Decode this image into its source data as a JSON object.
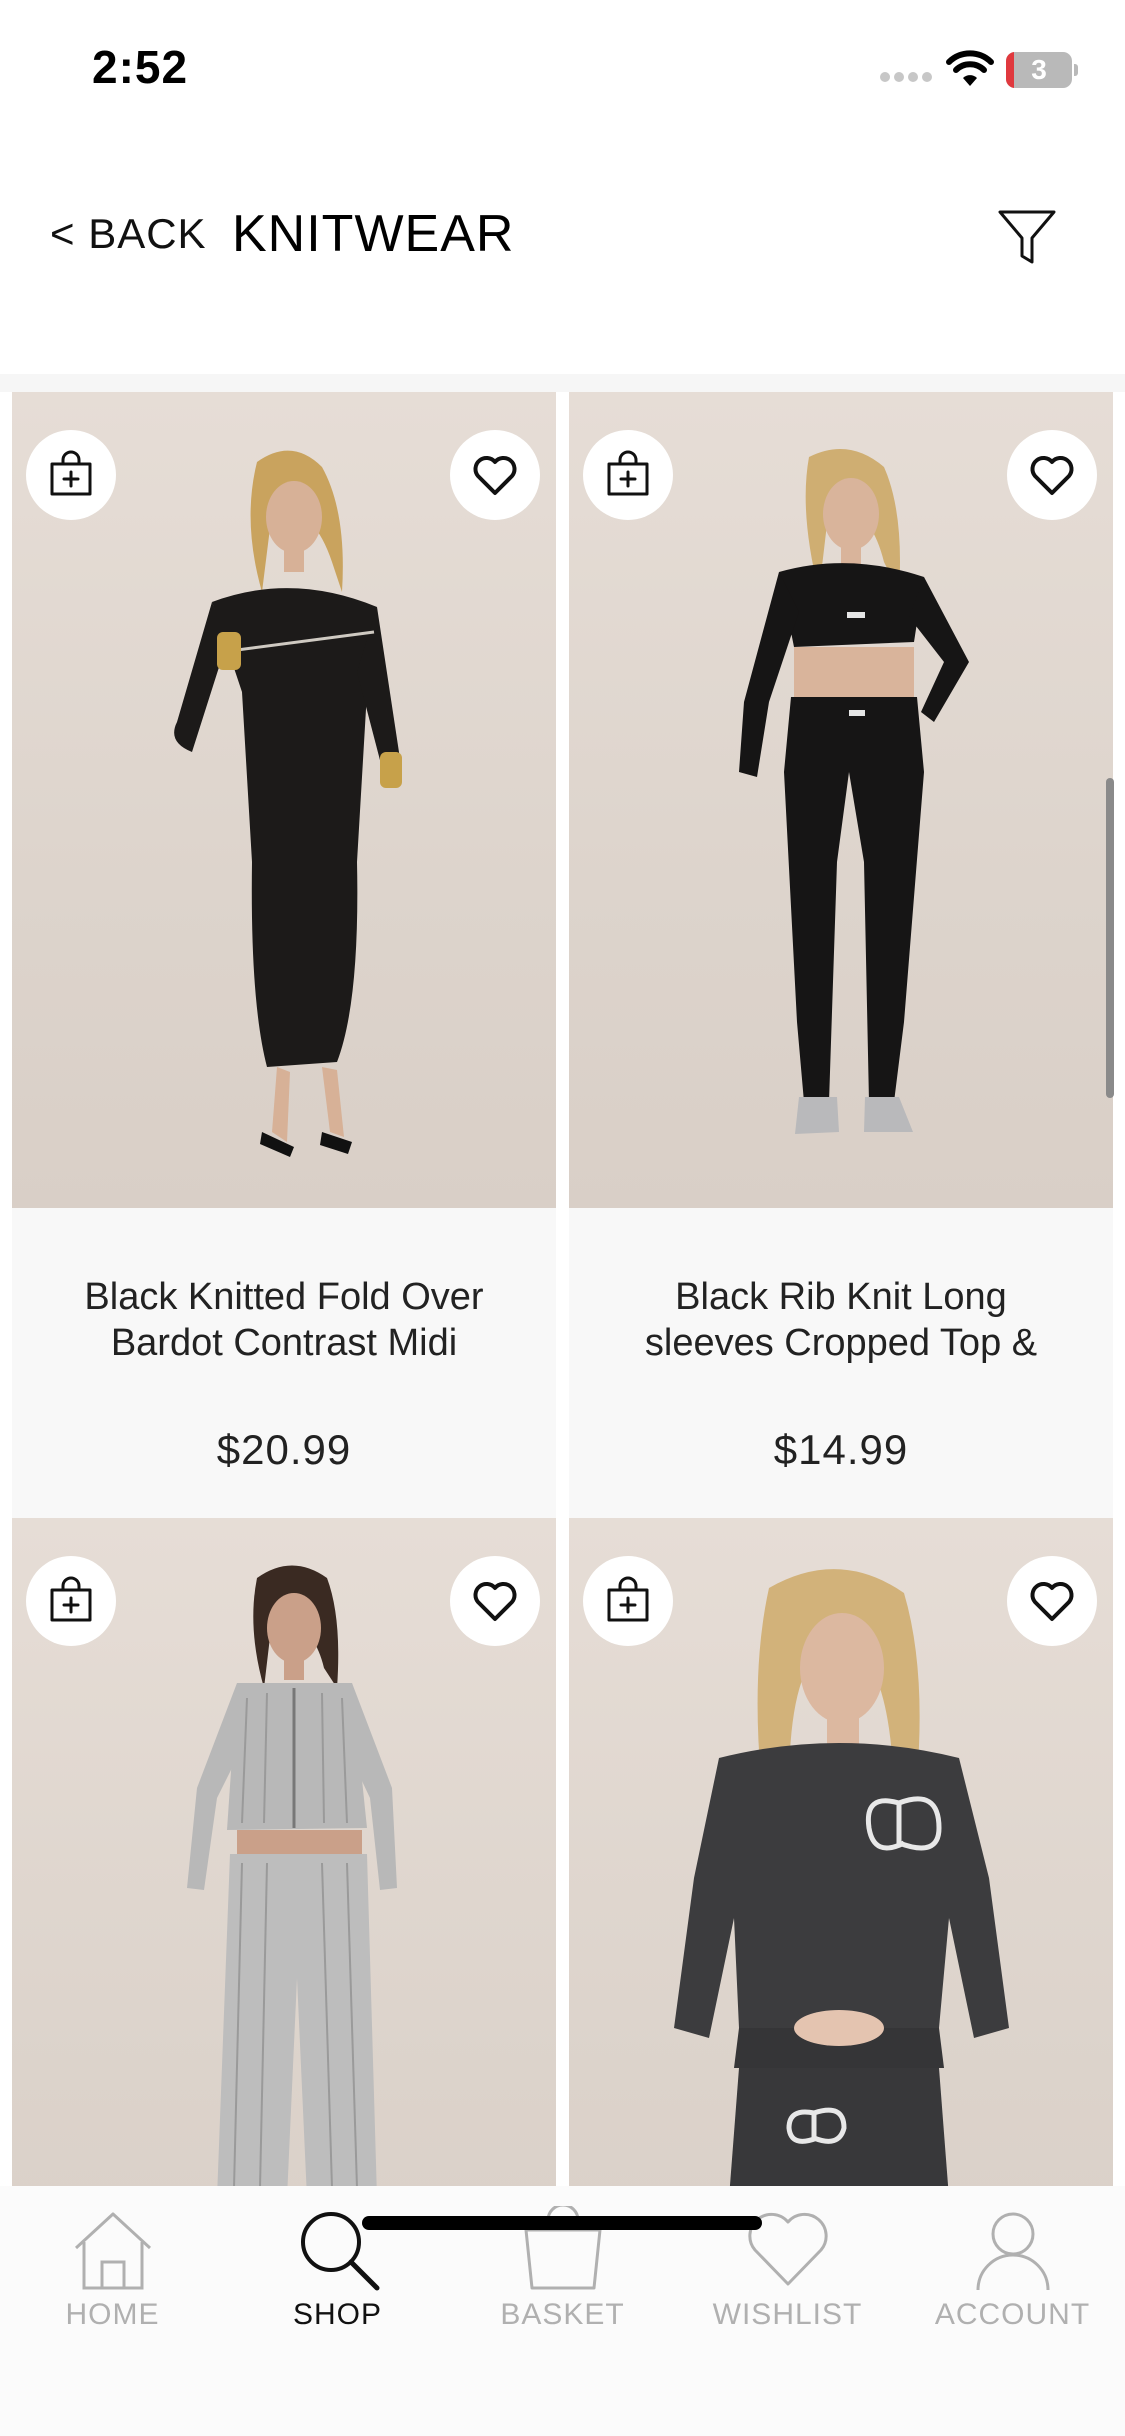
{
  "status_bar": {
    "time": "2:52",
    "battery_level": "3"
  },
  "header": {
    "back_label": "< BACK",
    "title": "KNITWEAR"
  },
  "products": [
    {
      "name": "Black Knitted Fold Over Bardot Contrast Midi",
      "price": "$20.99",
      "image": "model-black-midi-dress",
      "add_icon": "bag-plus-icon",
      "wishlist_icon": "heart-icon"
    },
    {
      "name": "Black Rib Knit Long sleeves Cropped Top &",
      "price": "$14.99",
      "image": "model-black-crop-top-leggings",
      "add_icon": "bag-plus-icon",
      "wishlist_icon": "heart-icon"
    },
    {
      "image": "model-grey-rib-knit-set",
      "add_icon": "bag-plus-icon",
      "wishlist_icon": "heart-icon"
    },
    {
      "image": "model-charcoal-knit-jumper",
      "add_icon": "bag-plus-icon",
      "wishlist_icon": "heart-icon"
    }
  ],
  "tab_bar": {
    "items": [
      {
        "label": "HOME",
        "icon": "home-icon",
        "active": false
      },
      {
        "label": "SHOP",
        "icon": "search-icon",
        "active": true
      },
      {
        "label": "BASKET",
        "icon": "basket-icon",
        "active": false
      },
      {
        "label": "WISHLIST",
        "icon": "heart-icon",
        "active": false
      },
      {
        "label": "ACCOUNT",
        "icon": "account-icon",
        "active": false
      }
    ]
  },
  "colors": {
    "active_tab": "#111111",
    "inactive_tab": "#b0b0b0",
    "card_background": "#f8f8f8",
    "photo_background": "#e2d9d1"
  }
}
